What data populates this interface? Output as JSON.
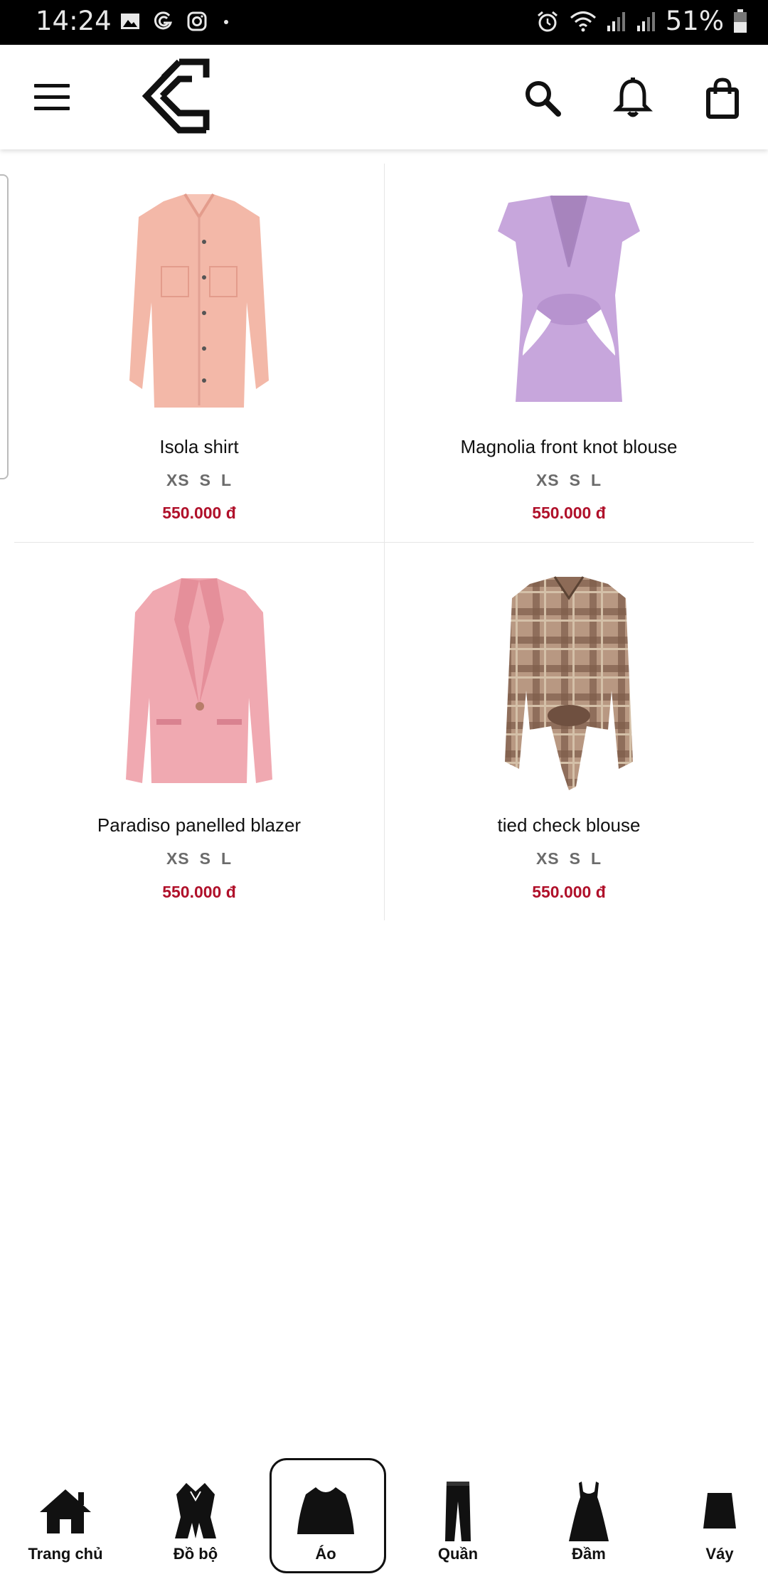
{
  "status_bar": {
    "time": "14:24",
    "battery": "51%",
    "icons_left": [
      "image-icon",
      "g-icon",
      "instagram-icon",
      "dot-icon"
    ],
    "icons_right": [
      "alarm-icon",
      "wifi-icon",
      "signal-icon",
      "signal-icon-2",
      "battery-icon"
    ]
  },
  "app_bar": {
    "menu_icon": "hamburger-icon",
    "logo": "brand-logo",
    "actions": [
      "search-icon",
      "bell-icon",
      "shopping-bag-icon"
    ]
  },
  "products": [
    {
      "name": "Isola shirt",
      "sizes": [
        "XS",
        "S",
        "L"
      ],
      "price": "550.000 đ",
      "image": "pink-shirt-image"
    },
    {
      "name": "Magnolia front knot blouse",
      "sizes": [
        "XS",
        "S",
        "L"
      ],
      "price": "550.000 đ",
      "image": "lilac-blouse-image"
    },
    {
      "name": "Paradiso panelled blazer",
      "sizes": [
        "XS",
        "S",
        "L"
      ],
      "price": "550.000 đ",
      "image": "pink-blazer-image"
    },
    {
      "name": "tied check blouse",
      "sizes": [
        "XS",
        "S",
        "L"
      ],
      "price": "550.000 đ",
      "image": "check-blouse-image"
    }
  ],
  "bottom_nav": [
    {
      "label": "Trang chủ",
      "icon": "home-icon"
    },
    {
      "label": "Đồ bộ",
      "icon": "outfit-icon"
    },
    {
      "label": "Áo",
      "icon": "top-icon",
      "active": true
    },
    {
      "label": "Quần",
      "icon": "pants-icon"
    },
    {
      "label": "Đầm",
      "icon": "dress-icon"
    },
    {
      "label": "Váy",
      "icon": "skirt-icon"
    }
  ],
  "colors": {
    "price": "#b0102a",
    "sizes": "#6b6b6b",
    "status_bar": "#000000"
  }
}
